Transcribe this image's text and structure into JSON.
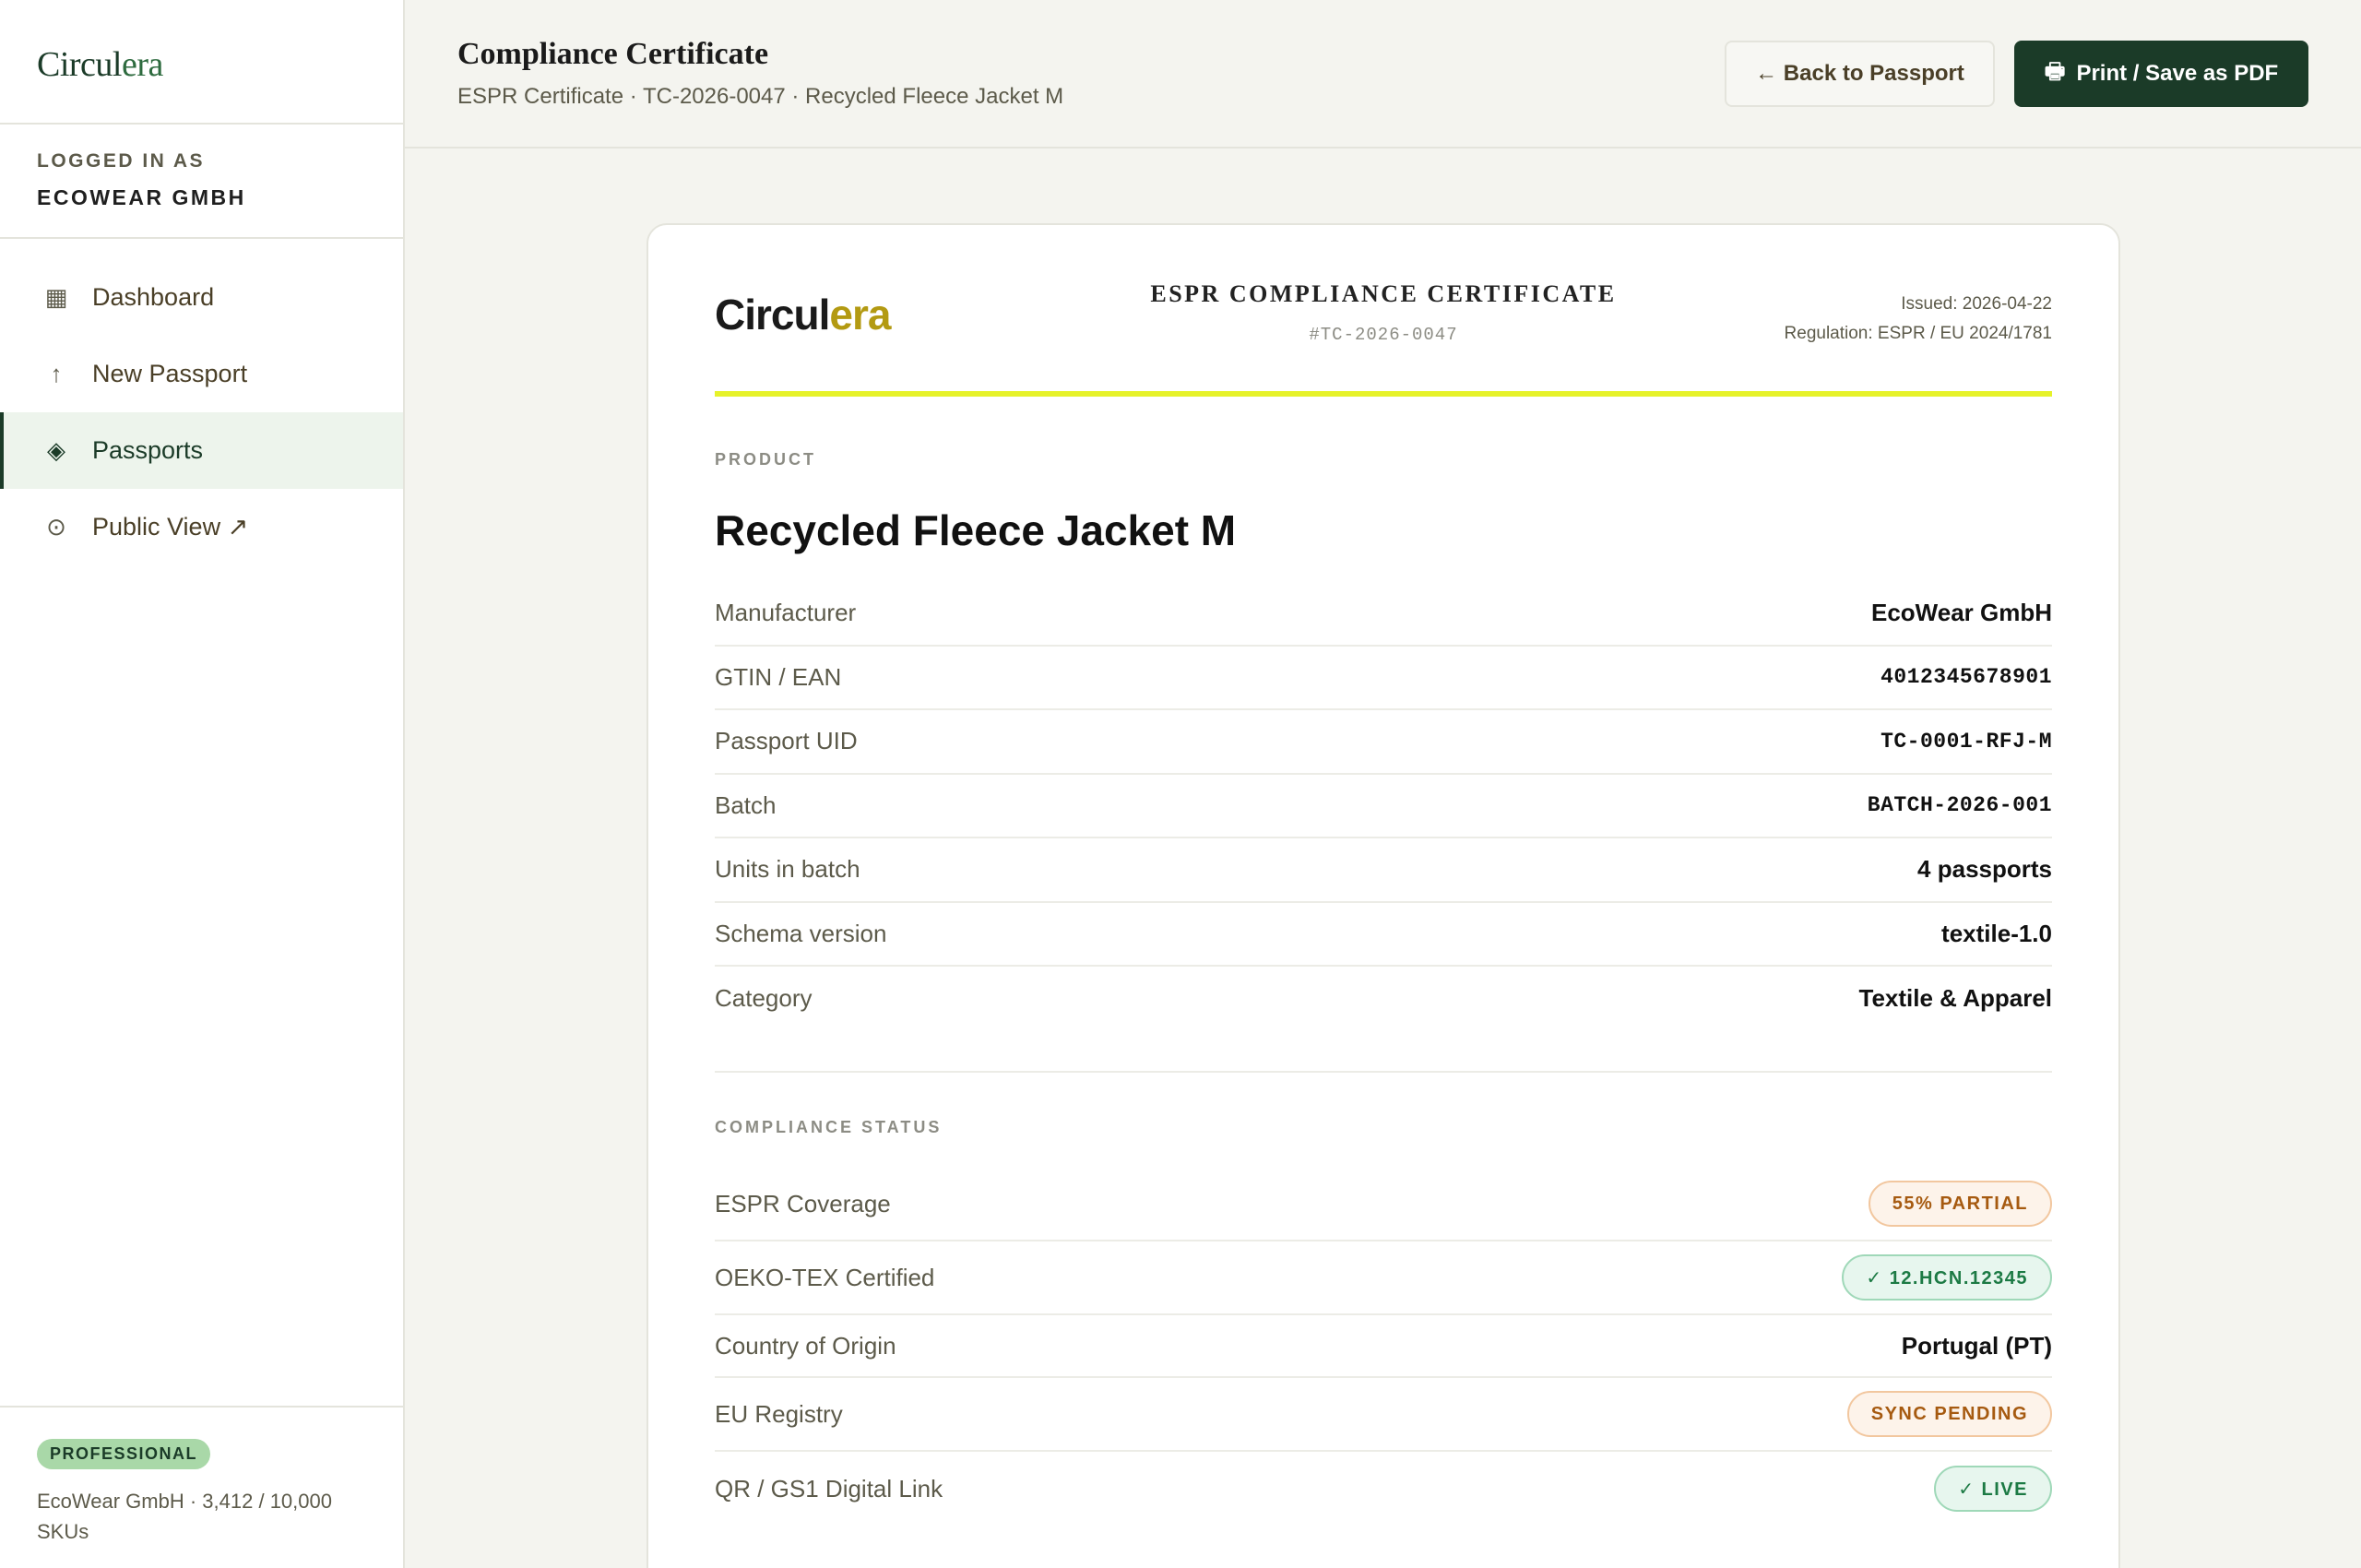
{
  "sidebar": {
    "brand_prefix": "Circul",
    "brand_suffix": "era",
    "logged_in_label": "LOGGED IN AS",
    "company": "ECOWEAR GMBH",
    "nav": [
      {
        "label": "Dashboard",
        "icon": "grid-icon",
        "glyph": "▦"
      },
      {
        "label": "New Passport",
        "icon": "arrow-up-icon",
        "glyph": "↑"
      },
      {
        "label": "Passports",
        "icon": "diamond-icon",
        "glyph": "◈"
      },
      {
        "label": "Public View ↗",
        "icon": "target-icon",
        "glyph": "⊙"
      }
    ],
    "plan_badge": "PROFESSIONAL",
    "usage": "EcoWear GmbH · 3,412 / 10,000 SKUs"
  },
  "header": {
    "title": "Compliance Certificate",
    "breadcrumb": "ESPR Certificate · TC-2026-0047 · Recycled Fleece Jacket M",
    "back_label": "← Back to Passport",
    "print_label": "Print / Save as PDF",
    "print_icon": "🖶"
  },
  "certificate": {
    "brand_prefix": "Circul",
    "brand_suffix": "era",
    "title": "ESPR COMPLIANCE CERTIFICATE",
    "id": "#TC-2026-0047",
    "issued": "Issued: 2026-04-22",
    "regulation": "Regulation: ESPR / EU 2024/1781",
    "product_label": "PRODUCT",
    "product_name": "Recycled Fleece Jacket M",
    "fields": [
      {
        "label": "Manufacturer",
        "value": "EcoWear GmbH"
      },
      {
        "label": "GTIN / EAN",
        "value": "4012345678901"
      },
      {
        "label": "Passport UID",
        "value": "TC-0001-RFJ-M"
      },
      {
        "label": "Batch",
        "value": "BATCH-2026-001"
      },
      {
        "label": "Units in batch",
        "value": "4 passports"
      },
      {
        "label": "Schema version",
        "value": "textile-1.0"
      },
      {
        "label": "Category",
        "value": "Textile & Apparel"
      }
    ],
    "compliance_label": "COMPLIANCE STATUS",
    "status": [
      {
        "label": "ESPR Coverage",
        "value": "55% PARTIAL"
      },
      {
        "label": "OEKO-TEX Certified",
        "value": "✓ 12.HCN.12345"
      },
      {
        "label": "Country of Origin",
        "value": "Portugal (PT)"
      },
      {
        "label": "EU Registry",
        "value": "SYNC PENDING"
      },
      {
        "label": "QR / GS1 Digital Link",
        "value": "✓ LIVE"
      }
    ]
  },
  "colors": {
    "brand_dark": "#1b3b28",
    "accent_yellow": "#e6f22a",
    "warn": "#a65a10",
    "ok": "#1c7a44"
  }
}
